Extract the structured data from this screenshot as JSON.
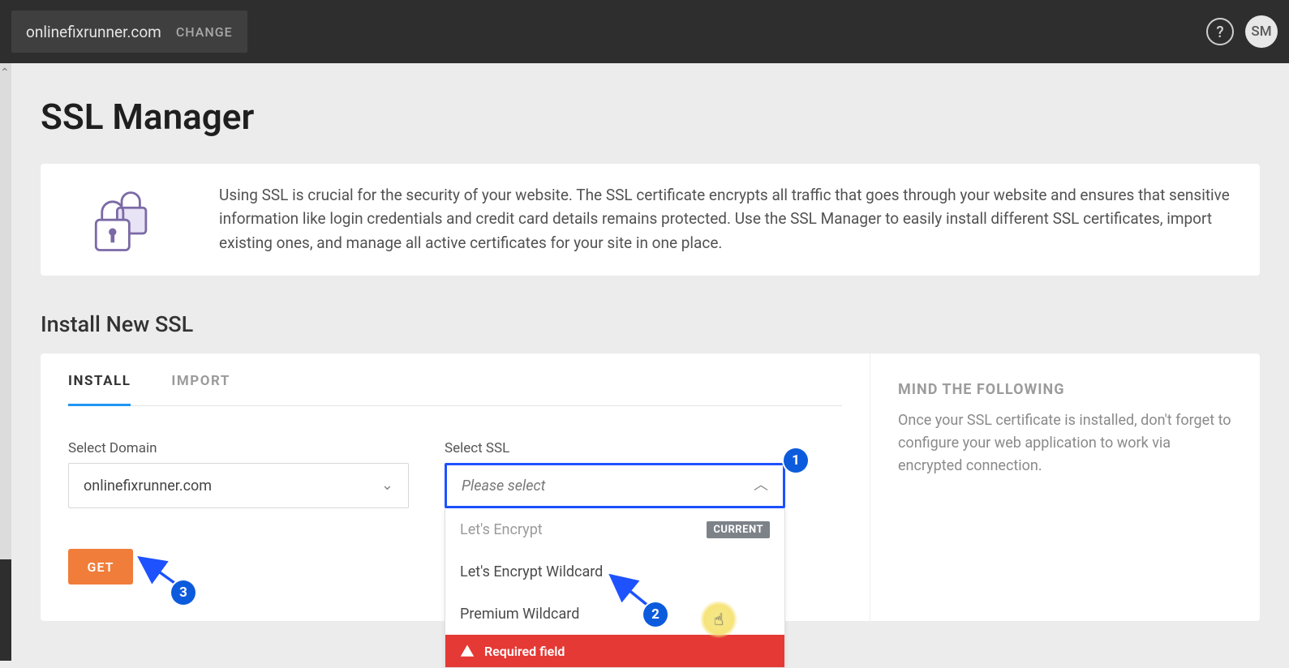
{
  "topbar": {
    "domain": "onlinefixrunner.com",
    "change_label": "CHANGE",
    "help_glyph": "?",
    "avatar_initials": "SM"
  },
  "page": {
    "title": "SSL Manager",
    "intro": "Using SSL is crucial for the security of your website. The SSL certificate encrypts all traffic that goes through your website and ensures that sensitive information like login credentials and credit card details remains protected. Use the SSL Manager to easily install different SSL certificates, import existing ones, and manage all active certificates for your site in one place.",
    "section_title": "Install New SSL"
  },
  "tabs": {
    "install": "INSTALL",
    "import": "IMPORT"
  },
  "form": {
    "domain_label": "Select Domain",
    "domain_value": "onlinefixrunner.com",
    "ssl_label": "Select SSL",
    "ssl_placeholder": "Please select",
    "get_label": "GET"
  },
  "ssl_options": {
    "item1": "Let's Encrypt",
    "item1_badge": "CURRENT",
    "item2": "Let's Encrypt Wildcard",
    "item3": "Premium Wildcard",
    "error": "Required field"
  },
  "aside": {
    "title": "MIND THE FOLLOWING",
    "text": "Once your SSL certificate is installed, don't forget to configure your web application to work via encrypted connection."
  },
  "annotations": {
    "n1": "1",
    "n2": "2",
    "n3": "3"
  }
}
